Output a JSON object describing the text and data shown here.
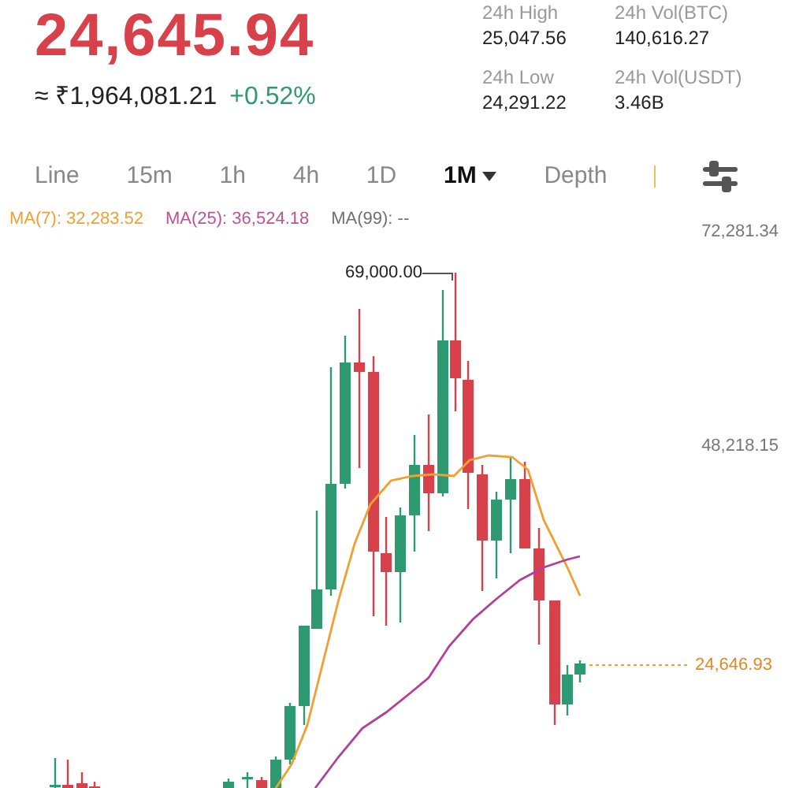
{
  "price": {
    "last": "24,645.94",
    "fiat": "≈ ₹1,964,081.21",
    "change": "+0.52%"
  },
  "stats": [
    {
      "label": "24h High",
      "value": "25,047.56"
    },
    {
      "label": "24h Vol(BTC)",
      "value": "140,616.27"
    },
    {
      "label": "24h Low",
      "value": "24,291.22"
    },
    {
      "label": "24h Vol(USDT)",
      "value": "3.46B"
    }
  ],
  "tabs": [
    {
      "label": "Line",
      "selected": false,
      "dropdown": false
    },
    {
      "label": "15m",
      "selected": false,
      "dropdown": false
    },
    {
      "label": "1h",
      "selected": false,
      "dropdown": false
    },
    {
      "label": "4h",
      "selected": false,
      "dropdown": false
    },
    {
      "label": "1D",
      "selected": false,
      "dropdown": false
    },
    {
      "label": "1M",
      "selected": true,
      "dropdown": true
    },
    {
      "label": "Depth",
      "selected": false,
      "dropdown": false
    }
  ],
  "chart": {
    "ma_legend": [
      {
        "label": "MA(7): 32,283.52",
        "color": "#f0a030"
      },
      {
        "label": "MA(25): 36,524.18",
        "color": "#c0509a"
      },
      {
        "label": "MA(99): --",
        "color": "#707070"
      }
    ],
    "price_labels": [
      "72,281.34",
      "48,218.15"
    ],
    "high_marker": "69,000.00",
    "last_price": "24,646.93"
  }
}
